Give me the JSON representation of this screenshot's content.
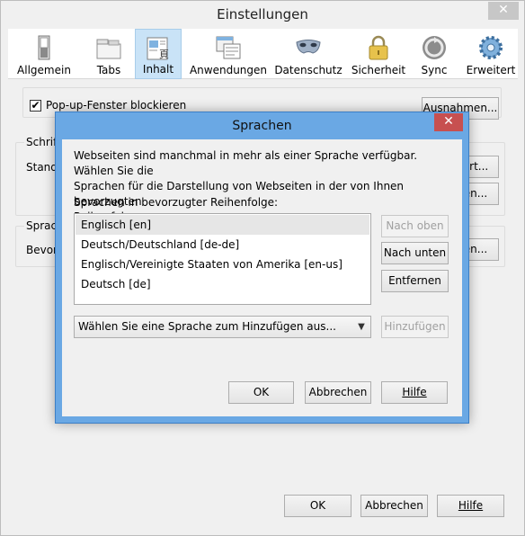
{
  "window": {
    "title": "Einstellungen",
    "close_glyph": "✕"
  },
  "toolbar": {
    "items": [
      {
        "label": "Allgemein",
        "icon": "switch-icon"
      },
      {
        "label": "Tabs",
        "icon": "tabs-icon"
      },
      {
        "label": "Inhalt",
        "icon": "content-icon",
        "selected": true
      },
      {
        "label": "Anwendungen",
        "icon": "applications-icon"
      },
      {
        "label": "Datenschutz",
        "icon": "mask-icon"
      },
      {
        "label": "Sicherheit",
        "icon": "lock-icon"
      },
      {
        "label": "Sync",
        "icon": "sync-icon"
      },
      {
        "label": "Erweitert",
        "icon": "gear-icon"
      }
    ]
  },
  "content": {
    "popup_checkbox_label": "Pop-up-Fenster blockieren",
    "popup_checked": true,
    "exceptions_button": "Ausnahmen...",
    "fonts_group_label": "Schrift",
    "standard_label": "Standa",
    "advanced_button_partial": "ert...",
    "colors_button_partial": "en...",
    "language_group_label": "Sprach",
    "preferred_label": "Bevorz",
    "choose_button_partial": "en..."
  },
  "footer": {
    "ok": "OK",
    "cancel": "Abbrechen",
    "help": "Hilfe"
  },
  "dialog": {
    "title": "Sprachen",
    "close_glyph": "✕",
    "description": [
      "Webseiten sind manchmal in mehr als einer Sprache verfügbar. Wählen Sie die",
      "Sprachen für die Darstellung von Webseiten in der von Ihnen bevorzugten",
      "Reihenfolge."
    ],
    "list_label": "Sprachen in bevorzugter Reihenfolge:",
    "languages": [
      "Englisch  [en]",
      "Deutsch/Deutschland  [de-de]",
      "Englisch/Vereinigte Staaten von Amerika  [en-us]",
      "Deutsch  [de]"
    ],
    "selected_index": 0,
    "move_up": "Nach oben",
    "move_down": "Nach unten",
    "remove": "Entfernen",
    "add_select_placeholder": "Wählen Sie eine Sprache zum Hinzufügen aus...",
    "add": "Hinzufügen",
    "ok": "OK",
    "cancel": "Abbrechen",
    "help": "Hilfe"
  }
}
